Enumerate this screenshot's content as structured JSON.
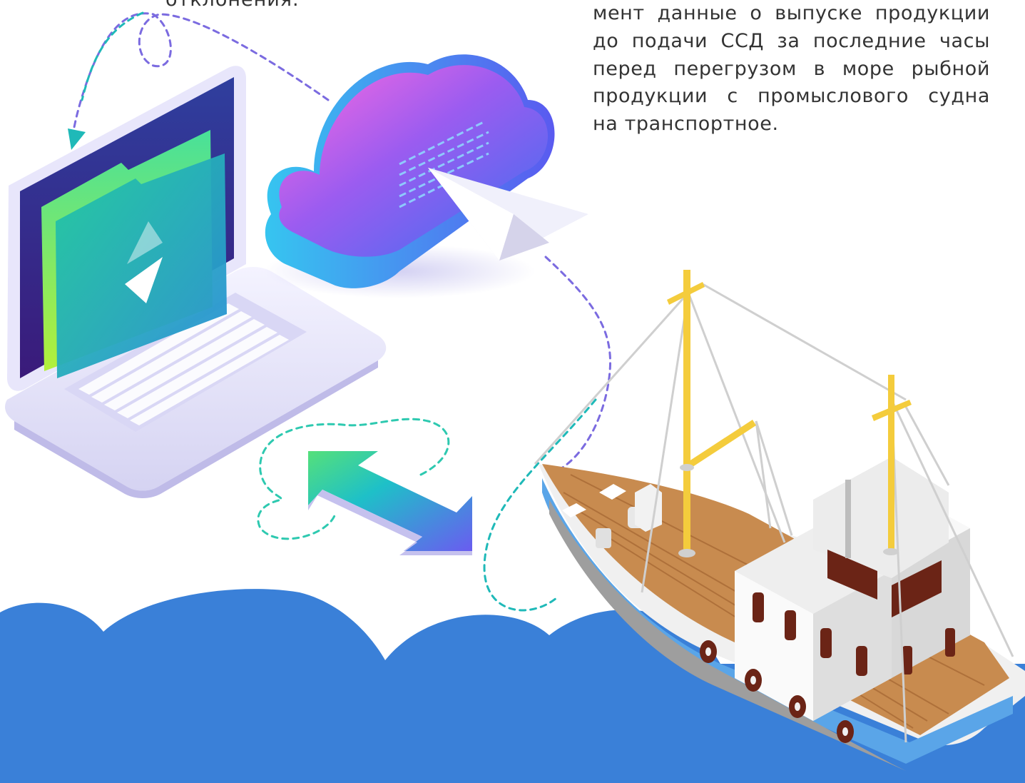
{
  "top_text": "отклонения.",
  "body_lines": [
    "мент данные о выпуске продукции",
    "до подачи ССД за последние часы",
    "перед перегрузом в море рыбной",
    "продукции с промыслового судна",
    "на транспортное."
  ],
  "colors": {
    "sea": "#3a80d8",
    "dash_teal": "#1fb9b8",
    "dash_purple": "#7b6be0",
    "dash_blue": "#4a6fd8",
    "deck_wood": "#c88b4f",
    "hull_blue": "#5aa5e8",
    "mast_yellow": "#f4cc3c",
    "window_brown": "#6b2416",
    "text": "#333333"
  },
  "icons": [
    "laptop-icon",
    "cloud-icon",
    "paper-plane-icon",
    "double-arrow-icon",
    "fishing-boat-icon"
  ]
}
